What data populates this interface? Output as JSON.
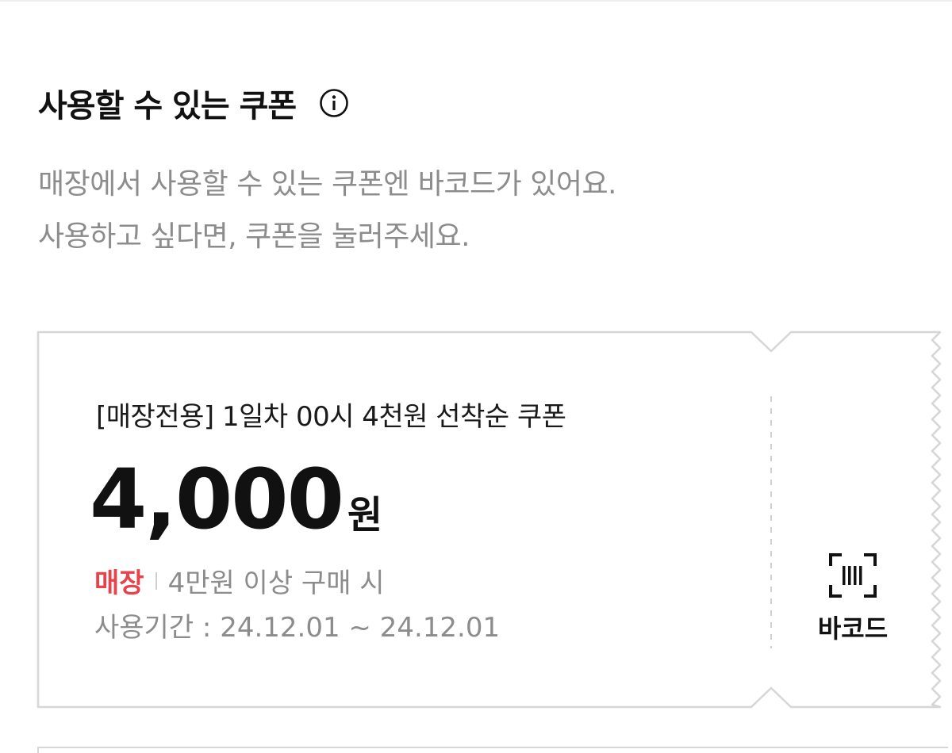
{
  "section": {
    "title": "사용할 수 있는 쿠폰",
    "info_icon": "info-circle-icon",
    "description_lines": [
      "매장에서 사용할 수 있는 쿠폰엔 바코드가 있어요.",
      "사용하고 싶다면, 쿠폰을 눌러주세요."
    ]
  },
  "coupon": {
    "name": "[매장전용] 1일차 00시 4천원 선착순 쿠폰",
    "amount": "4,000",
    "unit": "원",
    "store_badge": "매장",
    "condition": "4만원 이상 구매 시",
    "period": "사용기간 : 24.12.01 ~ 24.12.01",
    "barcode_label": "바코드",
    "barcode_icon": "barcode-scan-icon",
    "colors": {
      "store_badge": "#e8434a",
      "border": "#d6d6d6",
      "muted_text": "#8c8c8c"
    }
  }
}
